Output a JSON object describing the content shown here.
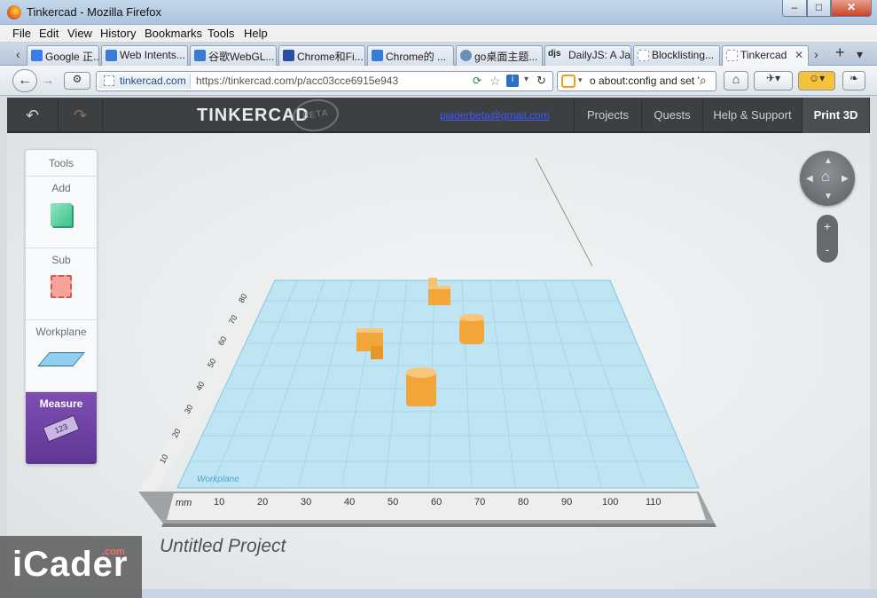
{
  "window": {
    "title": "Tinkercad - Mozilla Firefox",
    "minimize": "–",
    "maximize": "□",
    "close": "✕"
  },
  "menu": [
    "File",
    "Edit",
    "View",
    "History",
    "Bookmarks",
    "Tools",
    "Help"
  ],
  "tabs": [
    {
      "label": "Google 正...",
      "icon_color": "#3d7be8"
    },
    {
      "label": "Web Intents...",
      "icon_color": "#3a7bd5"
    },
    {
      "label": "谷歌WebGL...",
      "icon_color": "#3a7bd5"
    },
    {
      "label": "Chrome和Fi...",
      "icon_color": "#2a4fa0"
    },
    {
      "label": "Chrome的 ...",
      "icon_color": "#3a7bd5"
    },
    {
      "label": "go桌面主题...",
      "icon_color": "#6a8fb5"
    },
    {
      "label": "DailyJS: A Ja...",
      "icon_text": "djs"
    },
    {
      "label": "Blocklisting...",
      "icon_color": "#ffffff"
    },
    {
      "label": "Tinkercad",
      "icon_color": "#ffffff",
      "active": true
    }
  ],
  "tab_controls": {
    "scroll_left": "‹",
    "scroll_right": "›",
    "new_tab": "+",
    "list": "▾"
  },
  "nav": {
    "url_domain": "tinkercad.com",
    "url_prefix": "https://tinkercad.com",
    "url_path": "/p/acc03cce6915e943",
    "search_text": "o about:config and set ’",
    "back": "←",
    "forward": "→"
  },
  "app": {
    "logo": "TINKERCAD",
    "beta": "BETA",
    "email": "piaoerbeta@gmail.com",
    "menu": [
      "Projects",
      "Quests",
      "Help & Support",
      "Print 3D"
    ],
    "undo": "↶",
    "redo": "↷"
  },
  "tools": {
    "title": "Tools",
    "sections": [
      "Add",
      "Sub",
      "Workplane",
      "Measure"
    ],
    "measure_icon_text": "123"
  },
  "view_controls": {
    "zoom_in": "+",
    "zoom_out": "-"
  },
  "workplane": {
    "label": "Workplane",
    "unit": "mm",
    "x_ticks": [
      "10",
      "20",
      "30",
      "40",
      "50",
      "60",
      "70",
      "80",
      "90",
      "100",
      "110"
    ],
    "y_ticks": [
      "10",
      "20",
      "30",
      "40",
      "50",
      "60",
      "70",
      "80"
    ]
  },
  "project_name": "Untitled Project",
  "watermark": {
    "text": "iCader",
    "suffix": ".com"
  },
  "colors": {
    "accent_purple": "#6b3e9c",
    "header_bg": "#3d3f41",
    "grid": "#a9dcf0",
    "shape": "#f2a63a"
  }
}
